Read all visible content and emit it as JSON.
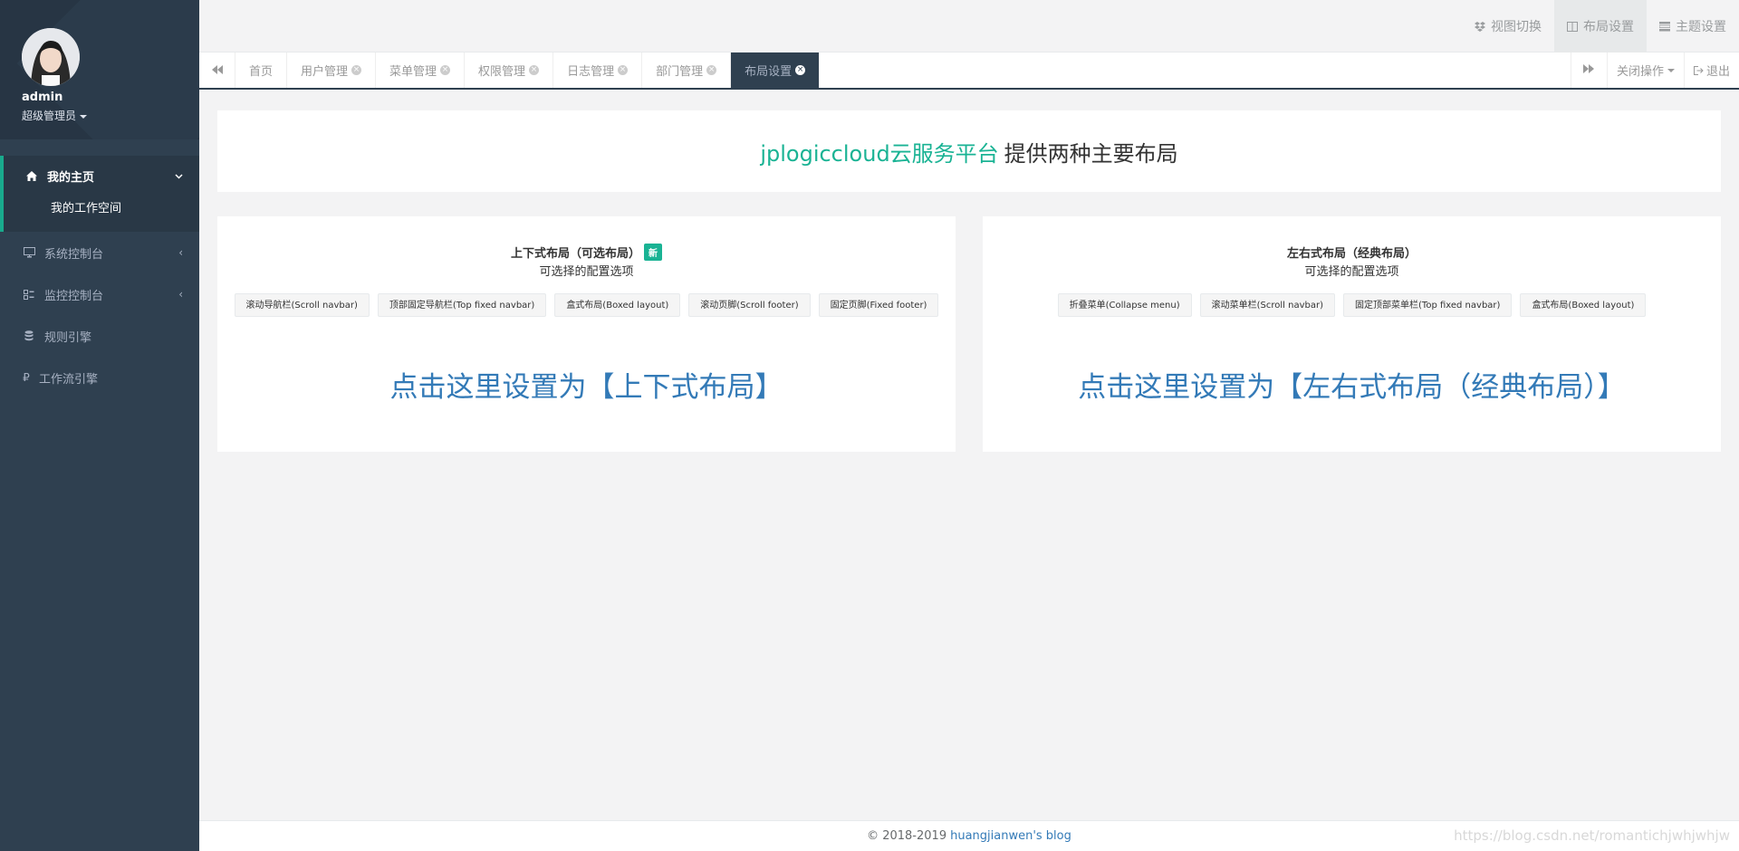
{
  "sidebar": {
    "username": "admin",
    "role": "超级管理员",
    "menu": [
      {
        "label": "我的主页",
        "icon": "home-icon"
      },
      {
        "label": "系统控制台",
        "icon": "desktop-icon"
      },
      {
        "label": "监控控制台",
        "icon": "monitor-icon"
      },
      {
        "label": "规则引擎",
        "icon": "database-icon"
      },
      {
        "label": "工作流引擎",
        "icon": "ruble-icon"
      }
    ],
    "submenu": [
      "我的工作空间"
    ]
  },
  "topbar": {
    "view_switch": "视图切换",
    "layout_settings": "布局设置",
    "theme_settings": "主题设置"
  },
  "tabs": [
    {
      "label": "首页"
    },
    {
      "label": "用户管理"
    },
    {
      "label": "菜单管理"
    },
    {
      "label": "权限管理"
    },
    {
      "label": "日志管理"
    },
    {
      "label": "部门管理"
    },
    {
      "label": "布局设置",
      "active": true
    }
  ],
  "tabs_right": {
    "close_ops": "关闭操作",
    "logout": "退出"
  },
  "banner": {
    "brand": "jplogiccloud云服务平台",
    "text": "提供两种主要布局"
  },
  "cards": {
    "top_down": {
      "title": "上下式布局（可选布局）",
      "badge": "新",
      "subtitle": "可选择的配置选项",
      "options": [
        "滚动导航栏(Scroll navbar)",
        "顶部固定导航栏(Top fixed navbar)",
        "盒式布局(Boxed layout)",
        "滚动页脚(Scroll footer)",
        "固定页脚(Fixed footer)"
      ],
      "link": "点击这里设置为【上下式布局】"
    },
    "left_right": {
      "title": "左右式布局（经典布局）",
      "subtitle": "可选择的配置选项",
      "options": [
        "折叠菜单(Collapse menu)",
        "滚动菜单栏(Scroll navbar)",
        "固定顶部菜单栏(Top fixed navbar)",
        "盒式布局(Boxed layout)"
      ],
      "link": "点击这里设置为【左右式布局（经典布局）】"
    }
  },
  "footer": {
    "copyright": "© 2018-2019",
    "blog": "huangjianwen's blog",
    "watermark": "https://blog.csdn.net/romantichjwhjwhjw"
  }
}
